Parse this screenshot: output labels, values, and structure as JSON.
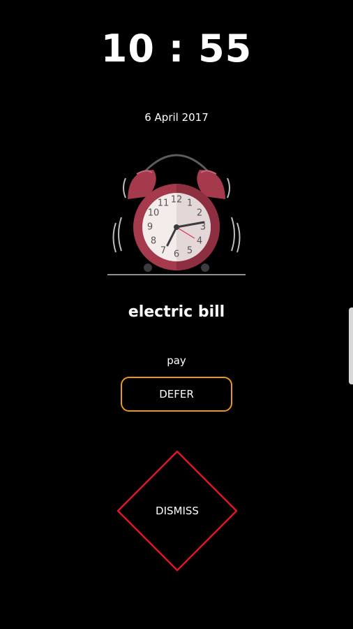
{
  "alarm": {
    "time": "10 : 55",
    "date": "6 April 2017",
    "title": "electric bill",
    "note": "pay"
  },
  "actions": {
    "defer_label": "DEFER",
    "dismiss_label": "DISMISS"
  },
  "clock_face": {
    "numerals": [
      "12",
      "1",
      "2",
      "3",
      "4",
      "5",
      "6",
      "7",
      "8",
      "9",
      "10",
      "11"
    ]
  },
  "icons": {
    "clock_illustration": "alarm-clock-icon",
    "edge_handle": "edge-panel-handle"
  },
  "colors": {
    "background": "#000000",
    "defer_border": "#e89a17",
    "dismiss_border": "#e0152a",
    "clock_body": "#a53a4c",
    "clock_face": "#f3eceb"
  }
}
